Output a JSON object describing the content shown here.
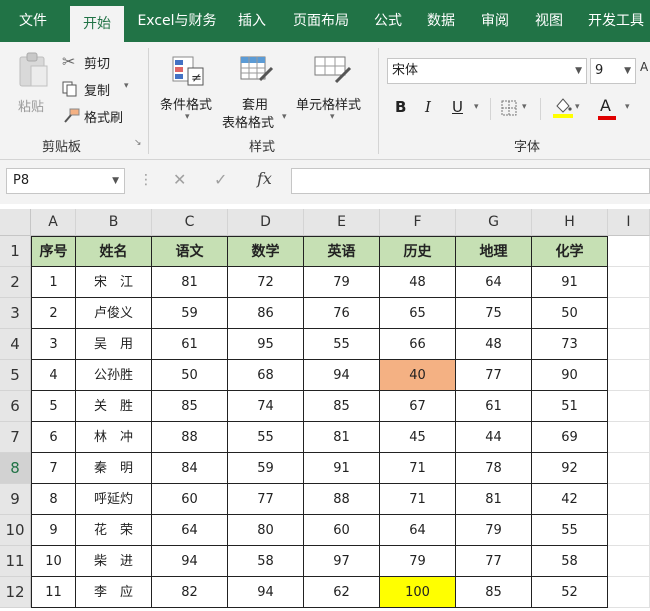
{
  "menu": {
    "tabs": [
      "文件",
      "开始",
      "Excel与财务",
      "插入",
      "页面布局",
      "公式",
      "数据",
      "审阅",
      "视图",
      "开发工具"
    ]
  },
  "ribbon": {
    "clipboard": {
      "paste": "粘贴",
      "cut": "剪切",
      "copy": "复制",
      "format_painter": "格式刷",
      "group_label": "剪贴板"
    },
    "styles": {
      "conditional_format": "条件格式",
      "table_format_line1": "套用",
      "table_format_line2": "表格格式",
      "cell_styles": "单元格样式",
      "group_label": "样式"
    },
    "font": {
      "font_name": "宋体",
      "font_size": "9",
      "bold": "B",
      "italic": "I",
      "underline": "U",
      "font_color_glyph": "A",
      "group_label": "字体"
    }
  },
  "formula_bar": {
    "name_box": "P8",
    "fx": "fx",
    "formula": ""
  },
  "sheet": {
    "columns": [
      "A",
      "B",
      "C",
      "D",
      "E",
      "F",
      "G",
      "H",
      "I"
    ],
    "row_numbers": [
      "1",
      "2",
      "3",
      "4",
      "5",
      "6",
      "7",
      "8",
      "9",
      "10",
      "11",
      "12"
    ],
    "selected_row": "8",
    "headers": [
      "序号",
      "姓名",
      "语文",
      "数学",
      "英语",
      "历史",
      "地理",
      "化学"
    ],
    "rows": [
      [
        "1",
        "宋　江",
        "81",
        "72",
        "79",
        "48",
        "64",
        "91"
      ],
      [
        "2",
        "卢俊义",
        "59",
        "86",
        "76",
        "65",
        "75",
        "50"
      ],
      [
        "3",
        "吴　用",
        "61",
        "95",
        "55",
        "66",
        "48",
        "73"
      ],
      [
        "4",
        "公孙胜",
        "50",
        "68",
        "94",
        "40",
        "77",
        "90"
      ],
      [
        "5",
        "关　胜",
        "85",
        "74",
        "85",
        "67",
        "61",
        "51"
      ],
      [
        "6",
        "林　冲",
        "88",
        "55",
        "81",
        "45",
        "44",
        "69"
      ],
      [
        "7",
        "秦　明",
        "84",
        "59",
        "91",
        "71",
        "78",
        "92"
      ],
      [
        "8",
        "呼延灼",
        "60",
        "77",
        "88",
        "71",
        "81",
        "42"
      ],
      [
        "9",
        "花　荣",
        "64",
        "80",
        "60",
        "64",
        "79",
        "55"
      ],
      [
        "10",
        "柴　进",
        "94",
        "58",
        "97",
        "79",
        "77",
        "58"
      ],
      [
        "11",
        "李　应",
        "82",
        "94",
        "62",
        "100",
        "85",
        "52"
      ]
    ],
    "highlights": [
      {
        "row": 4,
        "col": 5,
        "color": "#f4b183"
      },
      {
        "row": 11,
        "col": 5,
        "color": "#ffff00"
      }
    ]
  },
  "colors": {
    "brand": "#217346",
    "header_fill": "#c6e0b4",
    "low_highlight": "#f4b183",
    "high_highlight": "#ffff00"
  }
}
